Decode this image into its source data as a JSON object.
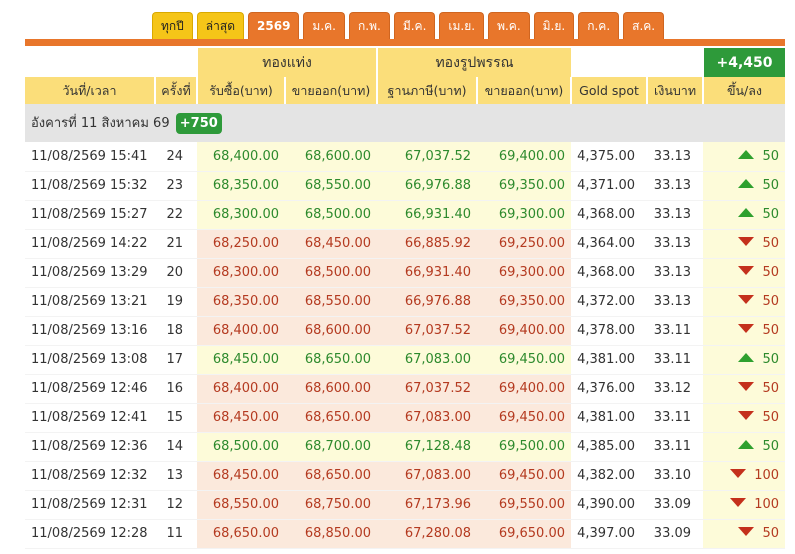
{
  "tabs": [
    {
      "label": "ทุกปี",
      "style": "yellow"
    },
    {
      "label": "ล่าสุด",
      "style": "yellow"
    },
    {
      "label": "2569",
      "style": "orange year"
    },
    {
      "label": "ม.ค.",
      "style": "orange"
    },
    {
      "label": "ก.พ.",
      "style": "orange"
    },
    {
      "label": "มี.ค.",
      "style": "orange"
    },
    {
      "label": "เม.ย.",
      "style": "orange"
    },
    {
      "label": "พ.ค.",
      "style": "orange"
    },
    {
      "label": "มิ.ย.",
      "style": "orange"
    },
    {
      "label": "ก.ค.",
      "style": "orange"
    },
    {
      "label": "ส.ค.",
      "style": "orange"
    }
  ],
  "header": {
    "group_bar": "ทองแท่ง",
    "group_ornament": "ทองรูปพรรณ",
    "total_change": "+4,450",
    "columns": {
      "datetime": "วันที่/เวลา",
      "count": "ครั้งที่",
      "bar_buy": "รับซื้อ(บาท)",
      "bar_sell": "ขายออก(บาท)",
      "orn_base": "ฐานภาษี(บาท)",
      "orn_sell": "ขายออก(บาท)",
      "spot": "Gold spot",
      "thb": "เงินบาท",
      "change": "ขึ้น/ลง"
    }
  },
  "day": {
    "label": "อังคารที่ 11 สิงหาคม 69",
    "change": "+750"
  },
  "colors": {
    "tab_yellow": "#f5c518",
    "tab_orange": "#e8762b",
    "header_bg": "#fbde7a",
    "up_green": "#2ea02e",
    "down_red": "#c4301c"
  },
  "rows": [
    {
      "datetime": "11/08/2569 15:41",
      "no": "24",
      "bar_buy": "68,400.00",
      "bar_sell": "68,600.00",
      "orn_base": "67,037.52",
      "orn_sell": "69,400.00",
      "spot": "4,375.00",
      "thb": "33.13",
      "dir": "up",
      "change": "50"
    },
    {
      "datetime": "11/08/2569 15:32",
      "no": "23",
      "bar_buy": "68,350.00",
      "bar_sell": "68,550.00",
      "orn_base": "66,976.88",
      "orn_sell": "69,350.00",
      "spot": "4,371.00",
      "thb": "33.13",
      "dir": "up",
      "change": "50"
    },
    {
      "datetime": "11/08/2569 15:27",
      "no": "22",
      "bar_buy": "68,300.00",
      "bar_sell": "68,500.00",
      "orn_base": "66,931.40",
      "orn_sell": "69,300.00",
      "spot": "4,368.00",
      "thb": "33.13",
      "dir": "up",
      "change": "50"
    },
    {
      "datetime": "11/08/2569 14:22",
      "no": "21",
      "bar_buy": "68,250.00",
      "bar_sell": "68,450.00",
      "orn_base": "66,885.92",
      "orn_sell": "69,250.00",
      "spot": "4,364.00",
      "thb": "33.13",
      "dir": "down",
      "change": "50"
    },
    {
      "datetime": "11/08/2569 13:29",
      "no": "20",
      "bar_buy": "68,300.00",
      "bar_sell": "68,500.00",
      "orn_base": "66,931.40",
      "orn_sell": "69,300.00",
      "spot": "4,368.00",
      "thb": "33.13",
      "dir": "down",
      "change": "50"
    },
    {
      "datetime": "11/08/2569 13:21",
      "no": "19",
      "bar_buy": "68,350.00",
      "bar_sell": "68,550.00",
      "orn_base": "66,976.88",
      "orn_sell": "69,350.00",
      "spot": "4,372.00",
      "thb": "33.13",
      "dir": "down",
      "change": "50"
    },
    {
      "datetime": "11/08/2569 13:16",
      "no": "18",
      "bar_buy": "68,400.00",
      "bar_sell": "68,600.00",
      "orn_base": "67,037.52",
      "orn_sell": "69,400.00",
      "spot": "4,378.00",
      "thb": "33.11",
      "dir": "down",
      "change": "50"
    },
    {
      "datetime": "11/08/2569 13:08",
      "no": "17",
      "bar_buy": "68,450.00",
      "bar_sell": "68,650.00",
      "orn_base": "67,083.00",
      "orn_sell": "69,450.00",
      "spot": "4,381.00",
      "thb": "33.11",
      "dir": "up",
      "change": "50"
    },
    {
      "datetime": "11/08/2569 12:46",
      "no": "16",
      "bar_buy": "68,400.00",
      "bar_sell": "68,600.00",
      "orn_base": "67,037.52",
      "orn_sell": "69,400.00",
      "spot": "4,376.00",
      "thb": "33.12",
      "dir": "down",
      "change": "50"
    },
    {
      "datetime": "11/08/2569 12:41",
      "no": "15",
      "bar_buy": "68,450.00",
      "bar_sell": "68,650.00",
      "orn_base": "67,083.00",
      "orn_sell": "69,450.00",
      "spot": "4,381.00",
      "thb": "33.11",
      "dir": "down",
      "change": "50"
    },
    {
      "datetime": "11/08/2569 12:36",
      "no": "14",
      "bar_buy": "68,500.00",
      "bar_sell": "68,700.00",
      "orn_base": "67,128.48",
      "orn_sell": "69,500.00",
      "spot": "4,385.00",
      "thb": "33.11",
      "dir": "up",
      "change": "50"
    },
    {
      "datetime": "11/08/2569 12:32",
      "no": "13",
      "bar_buy": "68,450.00",
      "bar_sell": "68,650.00",
      "orn_base": "67,083.00",
      "orn_sell": "69,450.00",
      "spot": "4,382.00",
      "thb": "33.10",
      "dir": "down",
      "change": "100"
    },
    {
      "datetime": "11/08/2569 12:31",
      "no": "12",
      "bar_buy": "68,550.00",
      "bar_sell": "68,750.00",
      "orn_base": "67,173.96",
      "orn_sell": "69,550.00",
      "spot": "4,390.00",
      "thb": "33.09",
      "dir": "down",
      "change": "100"
    },
    {
      "datetime": "11/08/2569 12:28",
      "no": "11",
      "bar_buy": "68,650.00",
      "bar_sell": "68,850.00",
      "orn_base": "67,280.08",
      "orn_sell": "69,650.00",
      "spot": "4,397.00",
      "thb": "33.09",
      "dir": "down",
      "change": "50"
    }
  ]
}
